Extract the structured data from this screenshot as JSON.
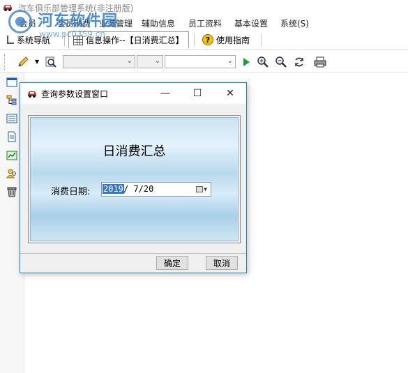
{
  "app": {
    "title": "汽车俱乐部管理系统(非注册版)"
  },
  "watermark": {
    "text": "河东软件园",
    "url": "www.pc0359.cn"
  },
  "menu": {
    "items": [
      "会员",
      "会员消费",
      "业务管理",
      "辅助信息",
      "员工资料",
      "基本设置",
      "系统(S)"
    ]
  },
  "tabs": [
    {
      "label": "系统导航"
    },
    {
      "label": "信息操作--【日消费汇总】"
    },
    {
      "label": "使用指南"
    }
  ],
  "dialog": {
    "title": "查询参数设置窗口",
    "minimize": "—",
    "maximize": "☐",
    "close": "✕",
    "panel_title": "日消费汇总",
    "date_label": "消费日期:",
    "date_year": "2019",
    "date_rest": "/ 7/20",
    "ok_label": "确定",
    "cancel_label": "取消"
  },
  "icons": {
    "toolbar": [
      "pencil-icon",
      "search-doc-icon",
      "play-icon",
      "zoom-in-icon",
      "zoom-out-icon",
      "refresh-icon",
      "print-icon"
    ],
    "leftbar": [
      "window-icon",
      "tree-icon",
      "list-icon",
      "document-icon",
      "chart-icon",
      "users-icon",
      "trash-icon"
    ]
  },
  "colors": {
    "accent": "#1883d7",
    "selection": "#3476d2",
    "watermark": "#2b7bd0"
  }
}
